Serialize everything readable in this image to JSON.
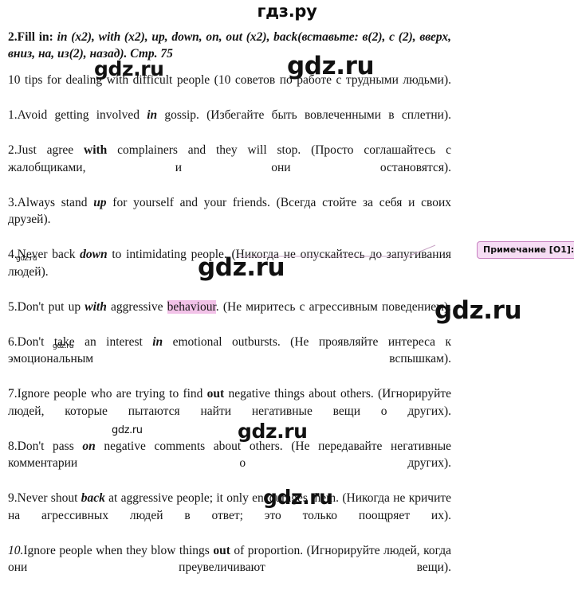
{
  "site": {
    "logo_text": "гдз.ру",
    "watermark_text": "gdz.ru"
  },
  "task": {
    "number": "2.",
    "label": "Fill in:",
    "prompt": "in (x2), with (x2), up, down, on, out (x2), back(вставьте: в(2), с (2), вверх, вниз, на, из(2), назад). Стр. 75"
  },
  "intro": {
    "en": "10 tips for dealing with difficult people",
    "ru": "(10 советов по работе с трудными людьми)."
  },
  "tips": [
    {
      "num": "1.",
      "en_before": "Avoid getting involved ",
      "answer": "in",
      "en_after": " gossip.",
      "ru": "(Избегайте быть вовлеченными в сплетни)."
    },
    {
      "num": "2.",
      "en_before": "Just agree ",
      "answer": "with",
      "en_after": " complainers and they will stop.",
      "ru": "(Просто соглашайтесь с жалобщиками, и они остановятся)."
    },
    {
      "num": "3.",
      "en_before": "Always stand ",
      "answer": "up",
      "en_after": " for yourself and your friends.",
      "ru": "(Всегда стойте за себя и своих друзей)."
    },
    {
      "num": "4.",
      "en_before": "Never back ",
      "answer": "down",
      "en_after": " to intimidating people.",
      "ru": "(Никогда не опускайтесь до запугивания людей)."
    },
    {
      "num": "5.",
      "en_before": "Don't put up ",
      "answer": "with",
      "en_after": " aggressive ",
      "highlighted": "behaviour",
      "en_tail": ".",
      "ru": "(Не миритесь с агрессивным поведением)."
    },
    {
      "num": "6.",
      "en_before": "Don't take an interest ",
      "answer": "in",
      "en_after": " emotional outbursts.",
      "ru": "(Не проявляйте интереса к эмоциональным вспышкам)."
    },
    {
      "num": "7.",
      "en_before": "Ignore people who are trying to find ",
      "answer": "out",
      "en_after": " negative things about others.",
      "ru": "(Игнорируйте людей, которые пытаются найти негативные вещи о других)."
    },
    {
      "num": "8.",
      "en_before": "Don't pass ",
      "answer": "on",
      "en_after": " negative comments about others.",
      "ru": "(Не передавайте негативные комментарии о других)."
    },
    {
      "num": "9.",
      "en_before": "Never shout ",
      "answer": "back",
      "en_after": " at aggressive people; it only encourages them.",
      "ru": "(Никогда не кричите на агрессивных людей в ответ; это только поощряет их)."
    },
    {
      "num": "10.",
      "en_before": "Ignore people when they blow things ",
      "answer": "out",
      "en_after": " of proportion.",
      "ru": "(Игнорируйте людей, когда они преувеличивают вещи)."
    }
  ],
  "comment": {
    "label": "Примечание [O1]:",
    "accent_color": "#c77fc0",
    "fill_color": "#f6ddf4",
    "highlight_color": "#f2c2e8"
  }
}
